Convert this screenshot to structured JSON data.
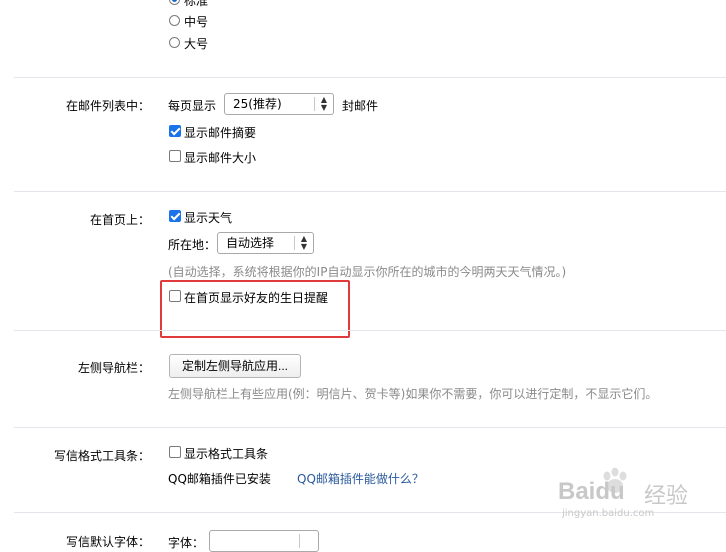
{
  "font_size": {
    "options": [
      {
        "label": "标准",
        "checked": true
      },
      {
        "label": "中号",
        "checked": false
      },
      {
        "label": "大号",
        "checked": false
      }
    ]
  },
  "mail_list": {
    "label": "在邮件列表中：",
    "per_page_prefix": "每页显示",
    "per_page_value": "25(推荐)",
    "per_page_suffix": "封邮件",
    "show_summary": {
      "label": "显示邮件摘要",
      "checked": true
    },
    "show_size": {
      "label": "显示邮件大小",
      "checked": false
    }
  },
  "homepage": {
    "label": "在首页上：",
    "show_weather": {
      "label": "显示天气",
      "checked": true
    },
    "location_label": "所在地：",
    "location_value": "自动选择",
    "auto_hint": "(自动选择，系统将根据你的IP自动显示你所在的城市的今明两天天气情况。)",
    "birthday": {
      "label": "在首页显示好友的生日提醒",
      "checked": false
    }
  },
  "left_nav": {
    "label": "左侧导航栏：",
    "button_label": "定制左侧导航应用...",
    "hint": "左侧导航栏上有些应用(例：明信片、贺卡等)如果你不需要，你可以进行定制，不显示它们。"
  },
  "format_toolbar": {
    "label": "写信格式工具条：",
    "show_toolbar": {
      "label": "显示格式工具条",
      "checked": false
    },
    "plugin_status": "QQ邮箱插件已安装",
    "plugin_link": "QQ邮箱插件能做什么？"
  },
  "default_font": {
    "label": "写信默认字体：",
    "font_label": "字体："
  },
  "watermark": {
    "brand": "Bai",
    "brand2": "du",
    "suffix": "经验",
    "url": "jingyan.baidu.com"
  },
  "colors": {
    "accent": "#1a73e8",
    "highlight": "#e03a3a",
    "link": "#2a5a9c",
    "hint": "#8a8a8a"
  }
}
